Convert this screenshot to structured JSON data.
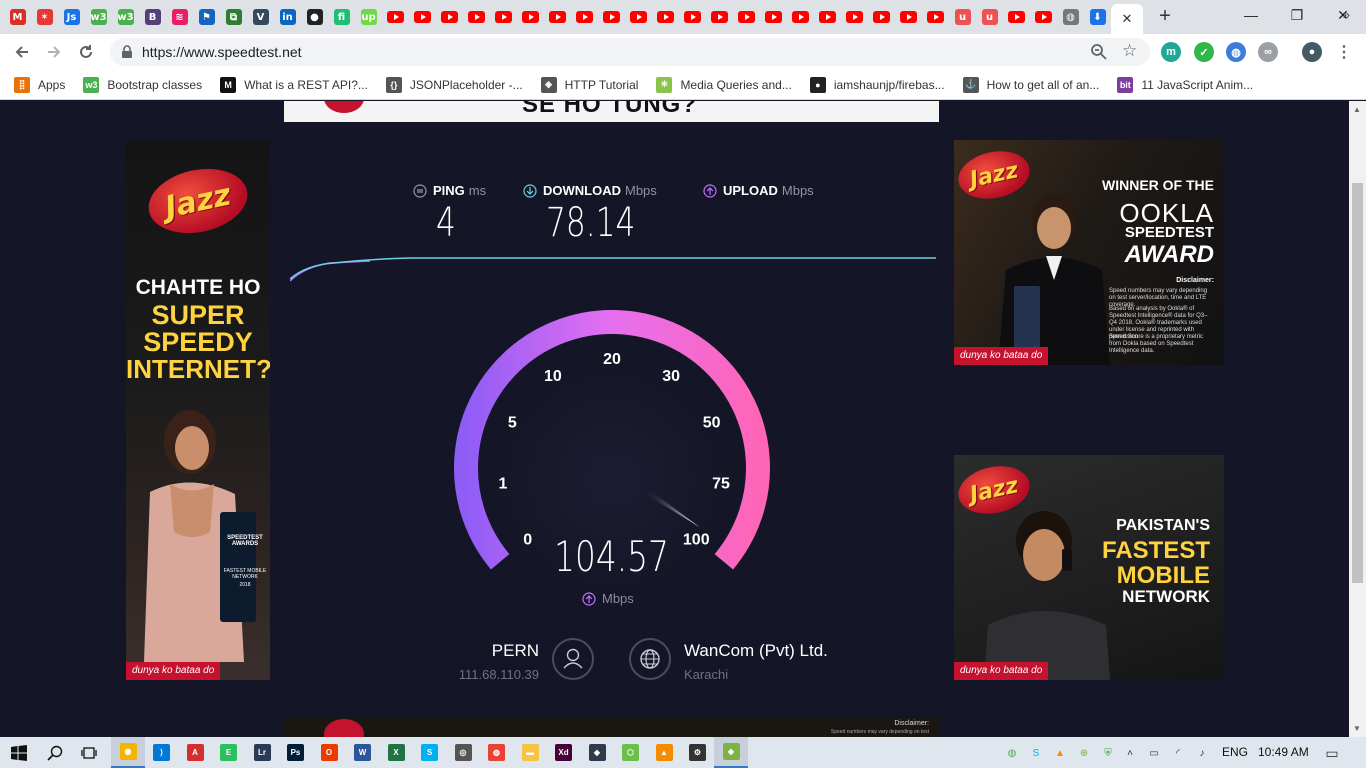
{
  "browser": {
    "url": "https://www.speedtest.net",
    "tab_close_symbol": "✕",
    "new_tab_symbol": "+",
    "window_buttons": [
      "—",
      "❐",
      "✕"
    ]
  },
  "tabs": [
    {
      "icon": "gmail-icon",
      "color": "#d93025",
      "glyph": "M"
    },
    {
      "icon": "figure-icon",
      "color": "#e53935",
      "glyph": "✶"
    },
    {
      "icon": "js-icon",
      "color": "#1a73e8",
      "glyph": "Js"
    },
    {
      "icon": "w3-icon",
      "color": "#4caf50",
      "glyph": "w3"
    },
    {
      "icon": "w3-icon",
      "color": "#4caf50",
      "glyph": "w3"
    },
    {
      "icon": "bootstrap-icon",
      "color": "#563d7c",
      "glyph": "B"
    },
    {
      "icon": "medium-swirl-icon",
      "color": "#e91e63",
      "glyph": "≋"
    },
    {
      "icon": "flag-icon",
      "color": "#1565c0",
      "glyph": "⚑"
    },
    {
      "icon": "codepen-icon",
      "color": "#2e7d32",
      "glyph": "⧉"
    },
    {
      "icon": "vue-icon",
      "color": "#35495e",
      "glyph": "V"
    },
    {
      "icon": "linkedin-icon",
      "color": "#0a66c2",
      "glyph": "in"
    },
    {
      "icon": "github-icon",
      "color": "#222222",
      "glyph": "●"
    },
    {
      "icon": "fiverr-icon",
      "color": "#1dbf73",
      "glyph": "fi"
    },
    {
      "icon": "upwork-icon",
      "color": "#6fda44",
      "glyph": "up"
    },
    {
      "icon": "youtube-icon",
      "yt": true
    },
    {
      "icon": "youtube-icon",
      "yt": true
    },
    {
      "icon": "youtube-icon",
      "yt": true
    },
    {
      "icon": "youtube-icon",
      "yt": true
    },
    {
      "icon": "youtube-icon",
      "yt": true
    },
    {
      "icon": "youtube-icon",
      "yt": true
    },
    {
      "icon": "youtube-icon",
      "yt": true
    },
    {
      "icon": "youtube-icon",
      "yt": true
    },
    {
      "icon": "youtube-icon",
      "yt": true
    },
    {
      "icon": "youtube-icon",
      "yt": true
    },
    {
      "icon": "youtube-icon",
      "yt": true
    },
    {
      "icon": "youtube-icon",
      "yt": true
    },
    {
      "icon": "youtube-icon",
      "yt": true
    },
    {
      "icon": "youtube-icon",
      "yt": true
    },
    {
      "icon": "youtube-icon",
      "yt": true
    },
    {
      "icon": "youtube-icon",
      "yt": true
    },
    {
      "icon": "youtube-icon",
      "yt": true
    },
    {
      "icon": "youtube-icon",
      "yt": true
    },
    {
      "icon": "youtube-icon",
      "yt": true
    },
    {
      "icon": "youtube-icon",
      "yt": true
    },
    {
      "icon": "youtube-icon",
      "yt": true
    },
    {
      "icon": "udemy-icon",
      "color": "#ec5252",
      "glyph": "u"
    },
    {
      "icon": "udemy-icon",
      "color": "#ec5252",
      "glyph": "u"
    },
    {
      "icon": "youtube-icon",
      "yt": true
    },
    {
      "icon": "youtube-icon",
      "yt": true
    },
    {
      "icon": "globe-icon",
      "color": "#777777",
      "glyph": "◍"
    },
    {
      "icon": "download-icon",
      "color": "#1a73e8",
      "glyph": "⬇"
    }
  ],
  "bookmarks": [
    {
      "label": "Apps",
      "icon": "apps-grid-icon",
      "color": "#e8710a",
      "glyph": "⣿"
    },
    {
      "label": "Bootstrap classes",
      "icon": "w3-icon",
      "color": "#4caf50",
      "glyph": "w3"
    },
    {
      "label": "What is a REST API?...",
      "icon": "medium-icon",
      "color": "#111111",
      "glyph": "M"
    },
    {
      "label": "JSONPlaceholder -...",
      "icon": "json-icon",
      "color": "#555555",
      "glyph": "{}"
    },
    {
      "label": "HTTP Tutorial",
      "icon": "diamond-icon",
      "color": "#555555",
      "glyph": "◈"
    },
    {
      "label": "Media Queries and...",
      "icon": "sparkle-icon",
      "color": "#8bc34a",
      "glyph": "✳"
    },
    {
      "label": "iamshaunjp/firebas...",
      "icon": "github-icon",
      "color": "#222222",
      "glyph": "●"
    },
    {
      "label": "How to get all of an...",
      "icon": "anchor-icon",
      "color": "#555555",
      "glyph": "⚓"
    },
    {
      "label": "11 JavaScript Anim...",
      "icon": "bit-icon",
      "color": "#7b3fa0",
      "glyph": "bit"
    }
  ],
  "bookmarks_more": "»",
  "top_ad": {
    "text": "SE HO TUNG?"
  },
  "bottom_ad": {
    "disclaimer_title": "Disclaimer:",
    "disclaimer_text": "Speed numbers may vary depending on test"
  },
  "left_ad": {
    "logo": "Jazz",
    "line1": "CHAHTE HO",
    "line2": "SUPER",
    "line3": "SPEEDY",
    "line4": "INTERNET?",
    "award": "SPEEDTEST AWARDS",
    "award_sub": "FASTEST MOBILE NETWORK",
    "award_year": "2018",
    "tagline": "dunya ko bataa do"
  },
  "right_ad1": {
    "logo": "Jazz",
    "line1": "WINNER OF THE",
    "line2": "OOKLA",
    "line3": "SPEEDTEST",
    "line4": "AWARD",
    "disclaimer_title": "Disclaimer:",
    "disclaimer_1": "Speed numbers may vary depending on test server/location, time and LTE coverage.",
    "disclaimer_2": "Based on analysis by Ookla® of Speedtest Intelligence® data for Q3–Q4 2018. Ookla® trademarks used under license and reprinted with permission.",
    "disclaimer_3": "Speed Score is a proprietary metric from Ookla based on Speedtest Intelligence data.",
    "tagline": "dunya ko bataa do"
  },
  "right_ad2": {
    "logo": "Jazz",
    "line1": "PAKISTAN'S",
    "line2": "FASTEST",
    "line3": "MOBILE",
    "line4": "NETWORK",
    "tagline": "dunya ko bataa do"
  },
  "speedtest": {
    "ping_label": "PING",
    "ping_unit": "ms",
    "ping_value": "4",
    "download_label": "DOWNLOAD",
    "download_unit": "Mbps",
    "download_value": "78.14",
    "upload_label": "UPLOAD",
    "upload_unit": "Mbps",
    "gauge_value": "104.57",
    "gauge_value_num": 104.57,
    "gauge_unit": "Mbps",
    "gauge_ticks": [
      "0",
      "1",
      "5",
      "10",
      "20",
      "30",
      "50",
      "75",
      "100"
    ],
    "host_name": "PERN",
    "host_ip": "111.68.110.39",
    "isp_name": "WanCom (Pvt) Ltd.",
    "isp_city": "Karachi",
    "colors": {
      "download": "#6ad1e3",
      "upload": "#bf71ff",
      "gauge_start": "#8f5df6",
      "gauge_end": "#ff65b6"
    }
  },
  "taskbar": {
    "apps": [
      {
        "icon": "chrome-icon",
        "color": "#f4b400",
        "glyph": "◉",
        "active": true
      },
      {
        "icon": "vscode-icon",
        "color": "#0078d4",
        "glyph": "⟩"
      },
      {
        "icon": "pdf-icon",
        "color": "#d32f2f",
        "glyph": "A"
      },
      {
        "icon": "evernote-icon",
        "color": "#2dbe60",
        "glyph": "E"
      },
      {
        "icon": "lightroom-icon",
        "color": "#2b3a55",
        "glyph": "Lr"
      },
      {
        "icon": "photoshop-icon",
        "color": "#001e36",
        "glyph": "Ps"
      },
      {
        "icon": "office-icon",
        "color": "#eb3c00",
        "glyph": "O"
      },
      {
        "icon": "word-icon",
        "color": "#2b579a",
        "glyph": "W"
      },
      {
        "icon": "excel-icon",
        "color": "#217346",
        "glyph": "X"
      },
      {
        "icon": "skype-icon",
        "color": "#00aff0",
        "glyph": "S"
      },
      {
        "icon": "davinci-icon",
        "color": "#555555",
        "glyph": "◎"
      },
      {
        "icon": "chrome-app-icon",
        "color": "#e94235",
        "glyph": "◍"
      },
      {
        "icon": "folder-icon",
        "color": "#f6c342",
        "glyph": "▬"
      },
      {
        "icon": "xd-icon",
        "color": "#470137",
        "glyph": "Xd"
      },
      {
        "icon": "git-icon",
        "color": "#2f3a4a",
        "glyph": "◆"
      },
      {
        "icon": "tower-icon",
        "color": "#6bc04b",
        "glyph": "⬡"
      },
      {
        "icon": "vlc-icon",
        "color": "#f48b00",
        "glyph": "▲"
      },
      {
        "icon": "settings-icon",
        "color": "#333333",
        "glyph": "⚙"
      },
      {
        "icon": "mixed-icon",
        "color": "#7cb342",
        "glyph": "◈",
        "active": true
      }
    ],
    "language": "ENG",
    "time": "10:49 AM"
  }
}
